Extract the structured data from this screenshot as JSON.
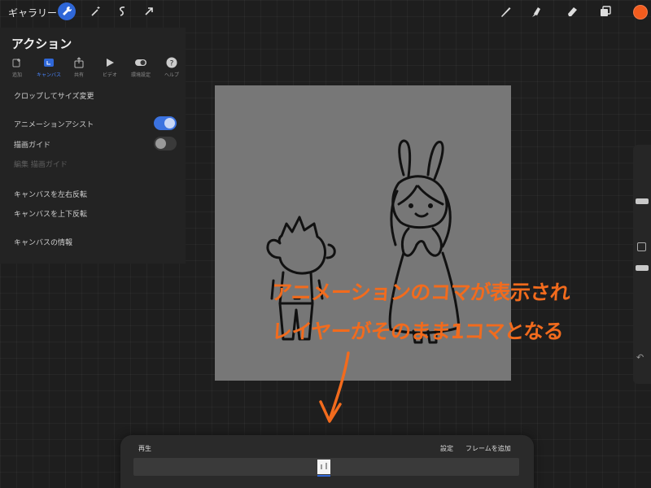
{
  "topbar": {
    "gallery_label": "ギャラリー",
    "tools_left": [
      "wrench-icon",
      "magic-wand-icon",
      "selection-icon",
      "transform-arrow-icon"
    ],
    "tools_right": [
      "brush-icon",
      "smudge-icon",
      "eraser-icon",
      "layers-icon"
    ],
    "color": "#f25c1e"
  },
  "actions": {
    "title": "アクション",
    "tabs": [
      {
        "label": "追加",
        "icon": "add-icon"
      },
      {
        "label": "キャンバス",
        "icon": "canvas-icon"
      },
      {
        "label": "共有",
        "icon": "share-icon"
      },
      {
        "label": "ビデオ",
        "icon": "video-icon"
      },
      {
        "label": "環境設定",
        "icon": "prefs-icon"
      },
      {
        "label": "ヘルプ",
        "icon": "help-icon"
      }
    ],
    "active_tab": "キャンバス",
    "items": {
      "crop": "クロップしてサイズ変更",
      "animation_assist": "アニメーションアシスト",
      "drawing_guide": "描画ガイド",
      "edit_drawing_guide": "編集 描画ガイド",
      "flip_h": "キャンバスを左右反転",
      "flip_v": "キャンバスを上下反転",
      "info": "キャンバスの情報"
    },
    "toggles": {
      "animation_assist": true,
      "drawing_guide": false
    }
  },
  "annotation": {
    "line1": "アニメーションのコマが表示され",
    "line2": "レイヤーがそのまま1コマとなる",
    "color": "#f26b1d"
  },
  "timeline": {
    "play": "再生",
    "settings": "設定",
    "add_frame": "フレームを追加",
    "frame_count": 1
  },
  "colors": {
    "accent": "#2f67d8",
    "canvas": "#777777",
    "background": "#1e1e1e"
  }
}
